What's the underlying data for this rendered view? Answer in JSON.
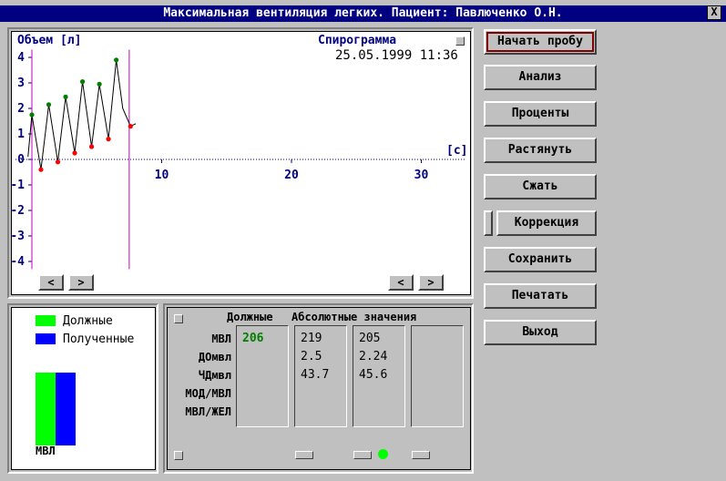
{
  "window": {
    "title": "Максимальная вентиляция легких. Пациент: Павлюченко О.Н.",
    "close_label": "X"
  },
  "chart": {
    "y_label": "Объем [л]",
    "x_label": "[с]",
    "panel_title": "Спирограмма",
    "datetime": "25.05.1999 11:36",
    "nav_left": "<",
    "nav_right": ">"
  },
  "chart_data": {
    "type": "line",
    "x_ticks": [
      10,
      20,
      30
    ],
    "y_ticks": [
      4,
      3,
      2,
      1,
      0,
      -1,
      -2,
      -3,
      -4
    ],
    "xlim": [
      -2,
      32
    ],
    "ylim": [
      -4.3,
      4.3
    ],
    "markers_x": [
      0,
      7.5
    ],
    "series": [
      {
        "x": [
          -0.3,
          0,
          0.7,
          1.3,
          2,
          2.6,
          3.3,
          3.9,
          4.6,
          5.2,
          5.9,
          6.5,
          7.0,
          7.6,
          8.0
        ],
        "y": [
          0.1,
          1.75,
          -0.4,
          2.15,
          -0.1,
          2.45,
          0.25,
          3.05,
          0.5,
          2.95,
          0.8,
          3.9,
          2.0,
          1.3,
          1.4
        ]
      }
    ],
    "peaks": [
      [
        0,
        1.75
      ],
      [
        1.3,
        2.15
      ],
      [
        2.6,
        2.45
      ],
      [
        3.9,
        3.05
      ],
      [
        5.2,
        2.95
      ],
      [
        6.5,
        3.9
      ]
    ],
    "troughs": [
      [
        0.7,
        -0.4
      ],
      [
        2,
        -0.1
      ],
      [
        3.3,
        0.25
      ],
      [
        4.6,
        0.5
      ],
      [
        5.9,
        0.8
      ],
      [
        7.6,
        1.3
      ]
    ],
    "line_color": "#000000",
    "peak_color": "#008000",
    "trough_color": "#ff0000",
    "marker_color": "#c000c0",
    "axis_color": "#000080"
  },
  "legend": {
    "due_label": "Должные",
    "obtained_label": "Полученные",
    "due_color": "#00ff00",
    "obtained_color": "#0000ff",
    "bar_label": "МВЛ"
  },
  "bars": {
    "due": 206,
    "obtained": 205
  },
  "table": {
    "header_due": "Должные",
    "header_abs": "Абсолютные значения",
    "rows": [
      "МВЛ",
      "ДОмвл",
      "ЧДмвл",
      "МОД/МВЛ",
      "МВЛ/ЖЕЛ"
    ],
    "col_due": [
      "206",
      "",
      "",
      "",
      ""
    ],
    "col_abs1": [
      "219",
      "2.5",
      "43.7",
      "",
      ""
    ],
    "col_abs2": [
      "205",
      "2.24",
      "45.6",
      "",
      ""
    ],
    "status_color": "#00ff00"
  },
  "buttons": {
    "start": "Начать пробу",
    "analysis": "Анализ",
    "percent": "Проценты",
    "stretch": "Растянуть",
    "compress": "Сжать",
    "correction": "Коррекция",
    "save": "Сохранить",
    "print": "Печатать",
    "exit": "Выход"
  }
}
